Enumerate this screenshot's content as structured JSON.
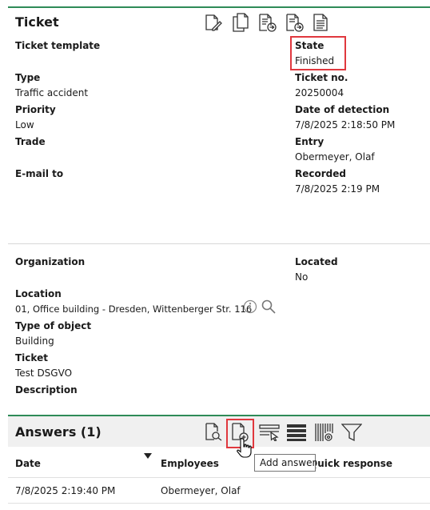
{
  "ticket": {
    "title": "Ticket",
    "fields_left": [
      {
        "label": "Ticket template",
        "value": ""
      },
      {
        "label": "Type",
        "value": "Traffic accident"
      },
      {
        "label": "Priority",
        "value": "Low"
      },
      {
        "label": "Trade",
        "value": ""
      },
      {
        "label": "E-mail to",
        "value": ""
      }
    ],
    "fields_right": [
      {
        "label": "State",
        "value": "Finished"
      },
      {
        "label": "Ticket no.",
        "value": "20250004"
      },
      {
        "label": "Date of detection",
        "value": "7/8/2025 2:18:50 PM"
      },
      {
        "label": "Entry",
        "value": "Obermeyer, Olaf"
      },
      {
        "label": "Recorded",
        "value": "7/8/2025 2:19 PM"
      }
    ],
    "toolbar_icons": [
      "edit-document-icon",
      "copy-document-icon",
      "forward-document-icon",
      "export-document-icon",
      "report-document-icon"
    ]
  },
  "details": {
    "organization_label": "Organization",
    "located_label": "Located",
    "located_value": "No",
    "location_label": "Location",
    "location_value": "01, Office building - Dresden, Wittenberger Str. 116",
    "type_of_object_label": "Type of object",
    "type_of_object_value": "Building",
    "ticket_label": "Ticket",
    "ticket_value": "Test DSGVO",
    "description_label": "Description"
  },
  "answers": {
    "title": "Answers (1)",
    "columns": [
      "Date",
      "Employees",
      "Quick response"
    ],
    "rows": [
      {
        "date": "7/8/2025 2:19:40 PM",
        "employee": "Obermeyer, Olaf",
        "quick_response": ""
      }
    ],
    "tooltip": "Add answer",
    "toolbar_icons": [
      "search-document-icon",
      "add-document-icon",
      "select-row-icon",
      "list-view-icon",
      "barcode-settings-icon",
      "filter-icon"
    ]
  },
  "colors": {
    "accent_green": "#2e8b57",
    "highlight_red": "#e0383e"
  }
}
